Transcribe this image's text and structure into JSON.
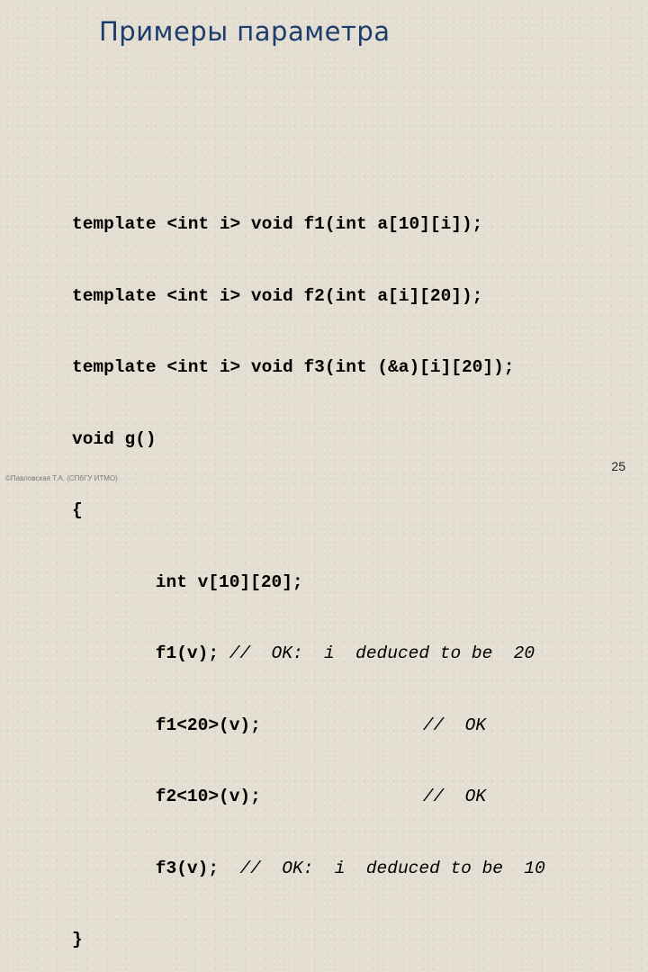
{
  "slide": {
    "title": "Примеры параметра",
    "code_lines": [
      "template <int i> void f1(int a[10][i]);",
      "template <int i> void f2(int a[i][20]);",
      "template <int i> void f3(int (&a)[i][20]);",
      "void g()",
      "{",
      "    int v[10][20];",
      "    f1(v);",
      "    f1<20>(v);",
      "    f2<10>(v);",
      "    f3(v);",
      "}"
    ],
    "comments": {
      "line7": "//  OK:  i  deduced to be  20",
      "line8": "//  OK",
      "line9": "//  OK",
      "line10": "//  OK:  i  deduced to be  10"
    },
    "footer": "©Павловская Т.А. (СПбГУ ИТМО)",
    "page_number": "25"
  }
}
